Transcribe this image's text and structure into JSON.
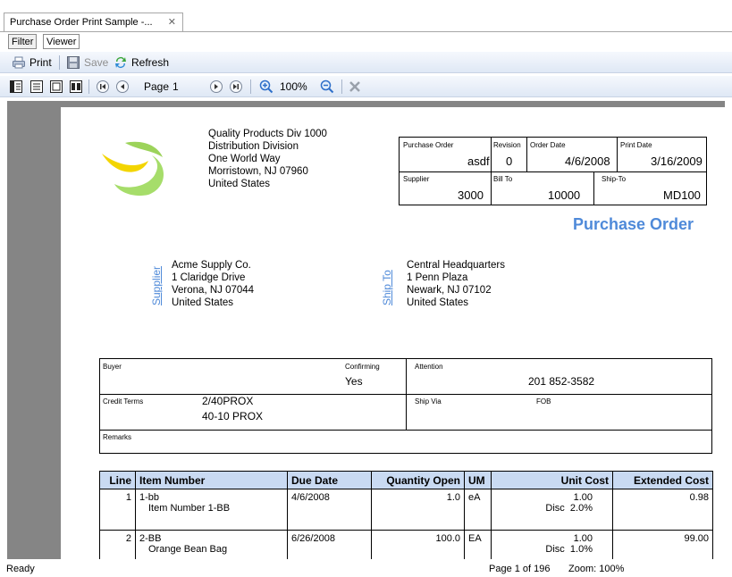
{
  "tab": {
    "title": "Purchase Order Print Sample -...",
    "close": "✕"
  },
  "subtabs": [
    "Filter",
    "Viewer"
  ],
  "toolbar": {
    "print": "Print",
    "save": "Save",
    "refresh": "Refresh"
  },
  "nav": {
    "page_label": "Page",
    "page_value": "1",
    "zoom": "100%"
  },
  "company": {
    "lines": [
      "Quality Products Div 1000",
      "Distribution Division",
      "One World Way",
      "Morristown, NJ 07960",
      "United States"
    ]
  },
  "header_box": {
    "purchase_order_label": "Purchase Order",
    "purchase_order": "asdf",
    "revision_label": "Revision",
    "revision": "0",
    "order_date_label": "Order Date",
    "order_date": "4/6/2008",
    "print_date_label": "Print Date",
    "print_date": "3/16/2009",
    "supplier_label": "Supplier",
    "supplier": "3000",
    "bill_to_label": "Bill To",
    "bill_to": "10000",
    "ship_to_label": "Ship-To",
    "ship_to": "MD100"
  },
  "doc_title": "Purchase Order",
  "supplier_block": {
    "label": "Supplier",
    "lines": [
      "Acme Supply Co.",
      "1 Claridge Drive",
      "Verona, NJ 07044",
      "United States"
    ]
  },
  "shipto_block": {
    "label": "Ship To",
    "lines": [
      "Central Headquarters",
      "1 Penn Plaza",
      "Newark, NJ 07102",
      "United States"
    ]
  },
  "info": {
    "buyer_label": "Buyer",
    "confirming_label": "Confirming",
    "confirming": "Yes",
    "attention_label": "Attention",
    "attention": "201 852-3582",
    "credit_terms_label": "Credit Terms",
    "credit_terms_1": "2/40PROX",
    "credit_terms_2": "40-10 PROX",
    "ship_via_label": "Ship Via",
    "fob_label": "FOB",
    "remarks_label": "Remarks"
  },
  "table": {
    "headers": [
      "Line",
      "Item Number",
      "Due Date",
      "Quantity Open",
      "UM",
      "Unit Cost",
      "Extended Cost"
    ],
    "rows": [
      {
        "line": "1",
        "item": "1-bb",
        "desc": "Item Number 1-BB",
        "due": "4/6/2008",
        "qty": "1.0",
        "um": "eA",
        "unit": "1.00",
        "disc_label": "Disc",
        "disc": "2.0%",
        "ext": "0.98"
      },
      {
        "line": "2",
        "item": "2-BB",
        "desc": "Orange Bean Bag",
        "due": "6/26/2008",
        "qty": "100.0",
        "um": "EA",
        "unit": "1.00",
        "disc_label": "Disc",
        "disc": "1.0%",
        "ext": "99.00"
      }
    ]
  },
  "status": {
    "ready": "Ready",
    "page": "Page 1 of 196",
    "zoom": "Zoom: 100%"
  },
  "colors": {
    "accent": "#4f8ad9",
    "table_header": "#c9daf2",
    "viewer_bg": "#858585"
  }
}
